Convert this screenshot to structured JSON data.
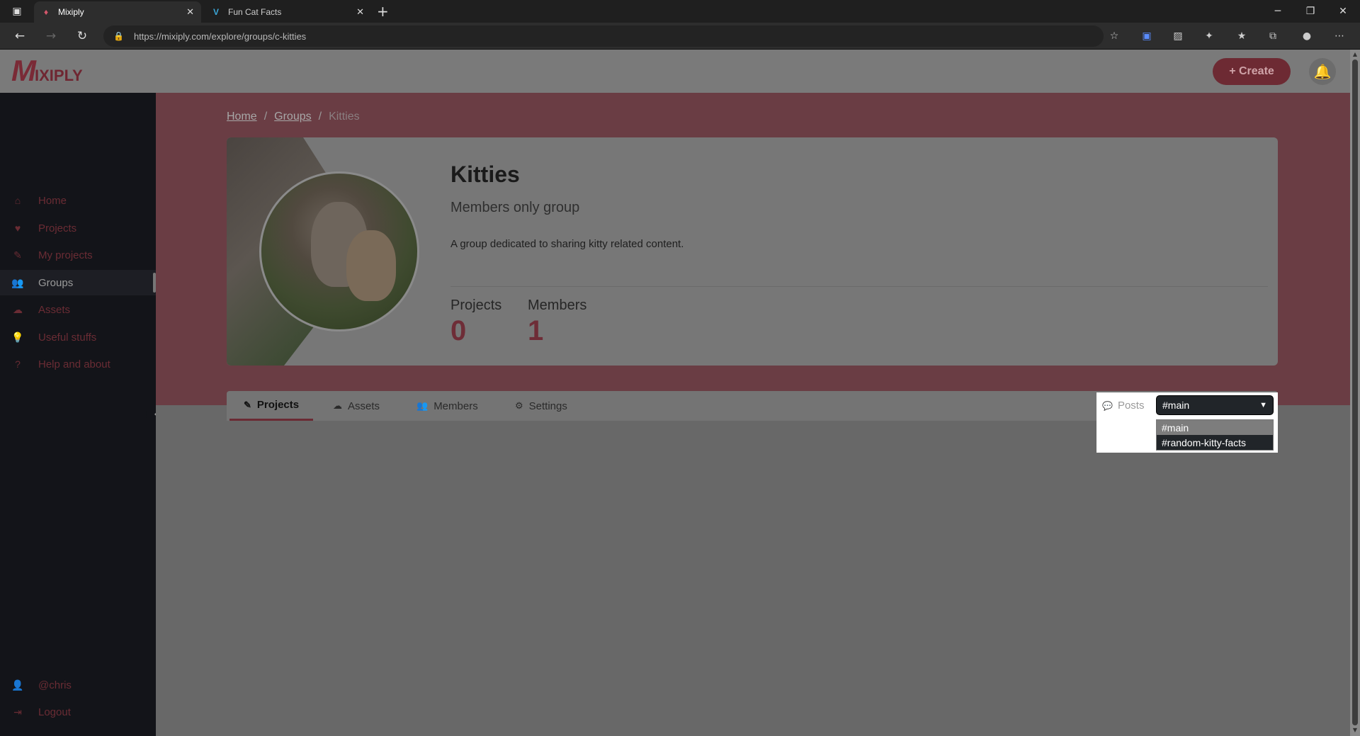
{
  "browser": {
    "tabs": [
      {
        "title": "Mixiply",
        "active": true
      },
      {
        "title": "Fun Cat Facts",
        "active": false
      }
    ],
    "url": "https://mixiply.com/explore/groups/c-kitties"
  },
  "header": {
    "logo_text_m": "M",
    "logo_text_rest": "IXIPLY",
    "create_label": "+ Create"
  },
  "sidebar": {
    "items": [
      {
        "label": "Home",
        "icon": "home-icon"
      },
      {
        "label": "Projects",
        "icon": "heart-icon"
      },
      {
        "label": "My projects",
        "icon": "brush-icon"
      },
      {
        "label": "Groups",
        "icon": "users-icon"
      },
      {
        "label": "Assets",
        "icon": "cloud-icon"
      },
      {
        "label": "Useful stuffs",
        "icon": "lightbulb-icon"
      },
      {
        "label": "Help and about",
        "icon": "question-icon"
      }
    ],
    "user": "@chris",
    "logout": "Logout"
  },
  "breadcrumb": {
    "home": "Home",
    "groups": "Groups",
    "current": "Kitties",
    "separator": "/"
  },
  "group": {
    "title": "Kitties",
    "subtitle": "Members only group",
    "description": "A group dedicated to sharing kitty related content.",
    "stats": [
      {
        "label": "Projects",
        "value": "0"
      },
      {
        "label": "Members",
        "value": "1"
      }
    ]
  },
  "tabs": [
    {
      "label": "Projects",
      "icon": "brush-icon",
      "active": true
    },
    {
      "label": "Assets",
      "icon": "cloud-icon",
      "active": false
    },
    {
      "label": "Members",
      "icon": "users-icon",
      "active": false
    },
    {
      "label": "Settings",
      "icon": "gear-icon",
      "active": false
    }
  ],
  "posts": {
    "label": "Posts",
    "selected": "#main",
    "options": [
      "#main",
      "#random-kitty-facts"
    ]
  },
  "colors": {
    "brand": "#c8546a",
    "overlay_dim": "rgba(0,0,0,0.55)"
  }
}
